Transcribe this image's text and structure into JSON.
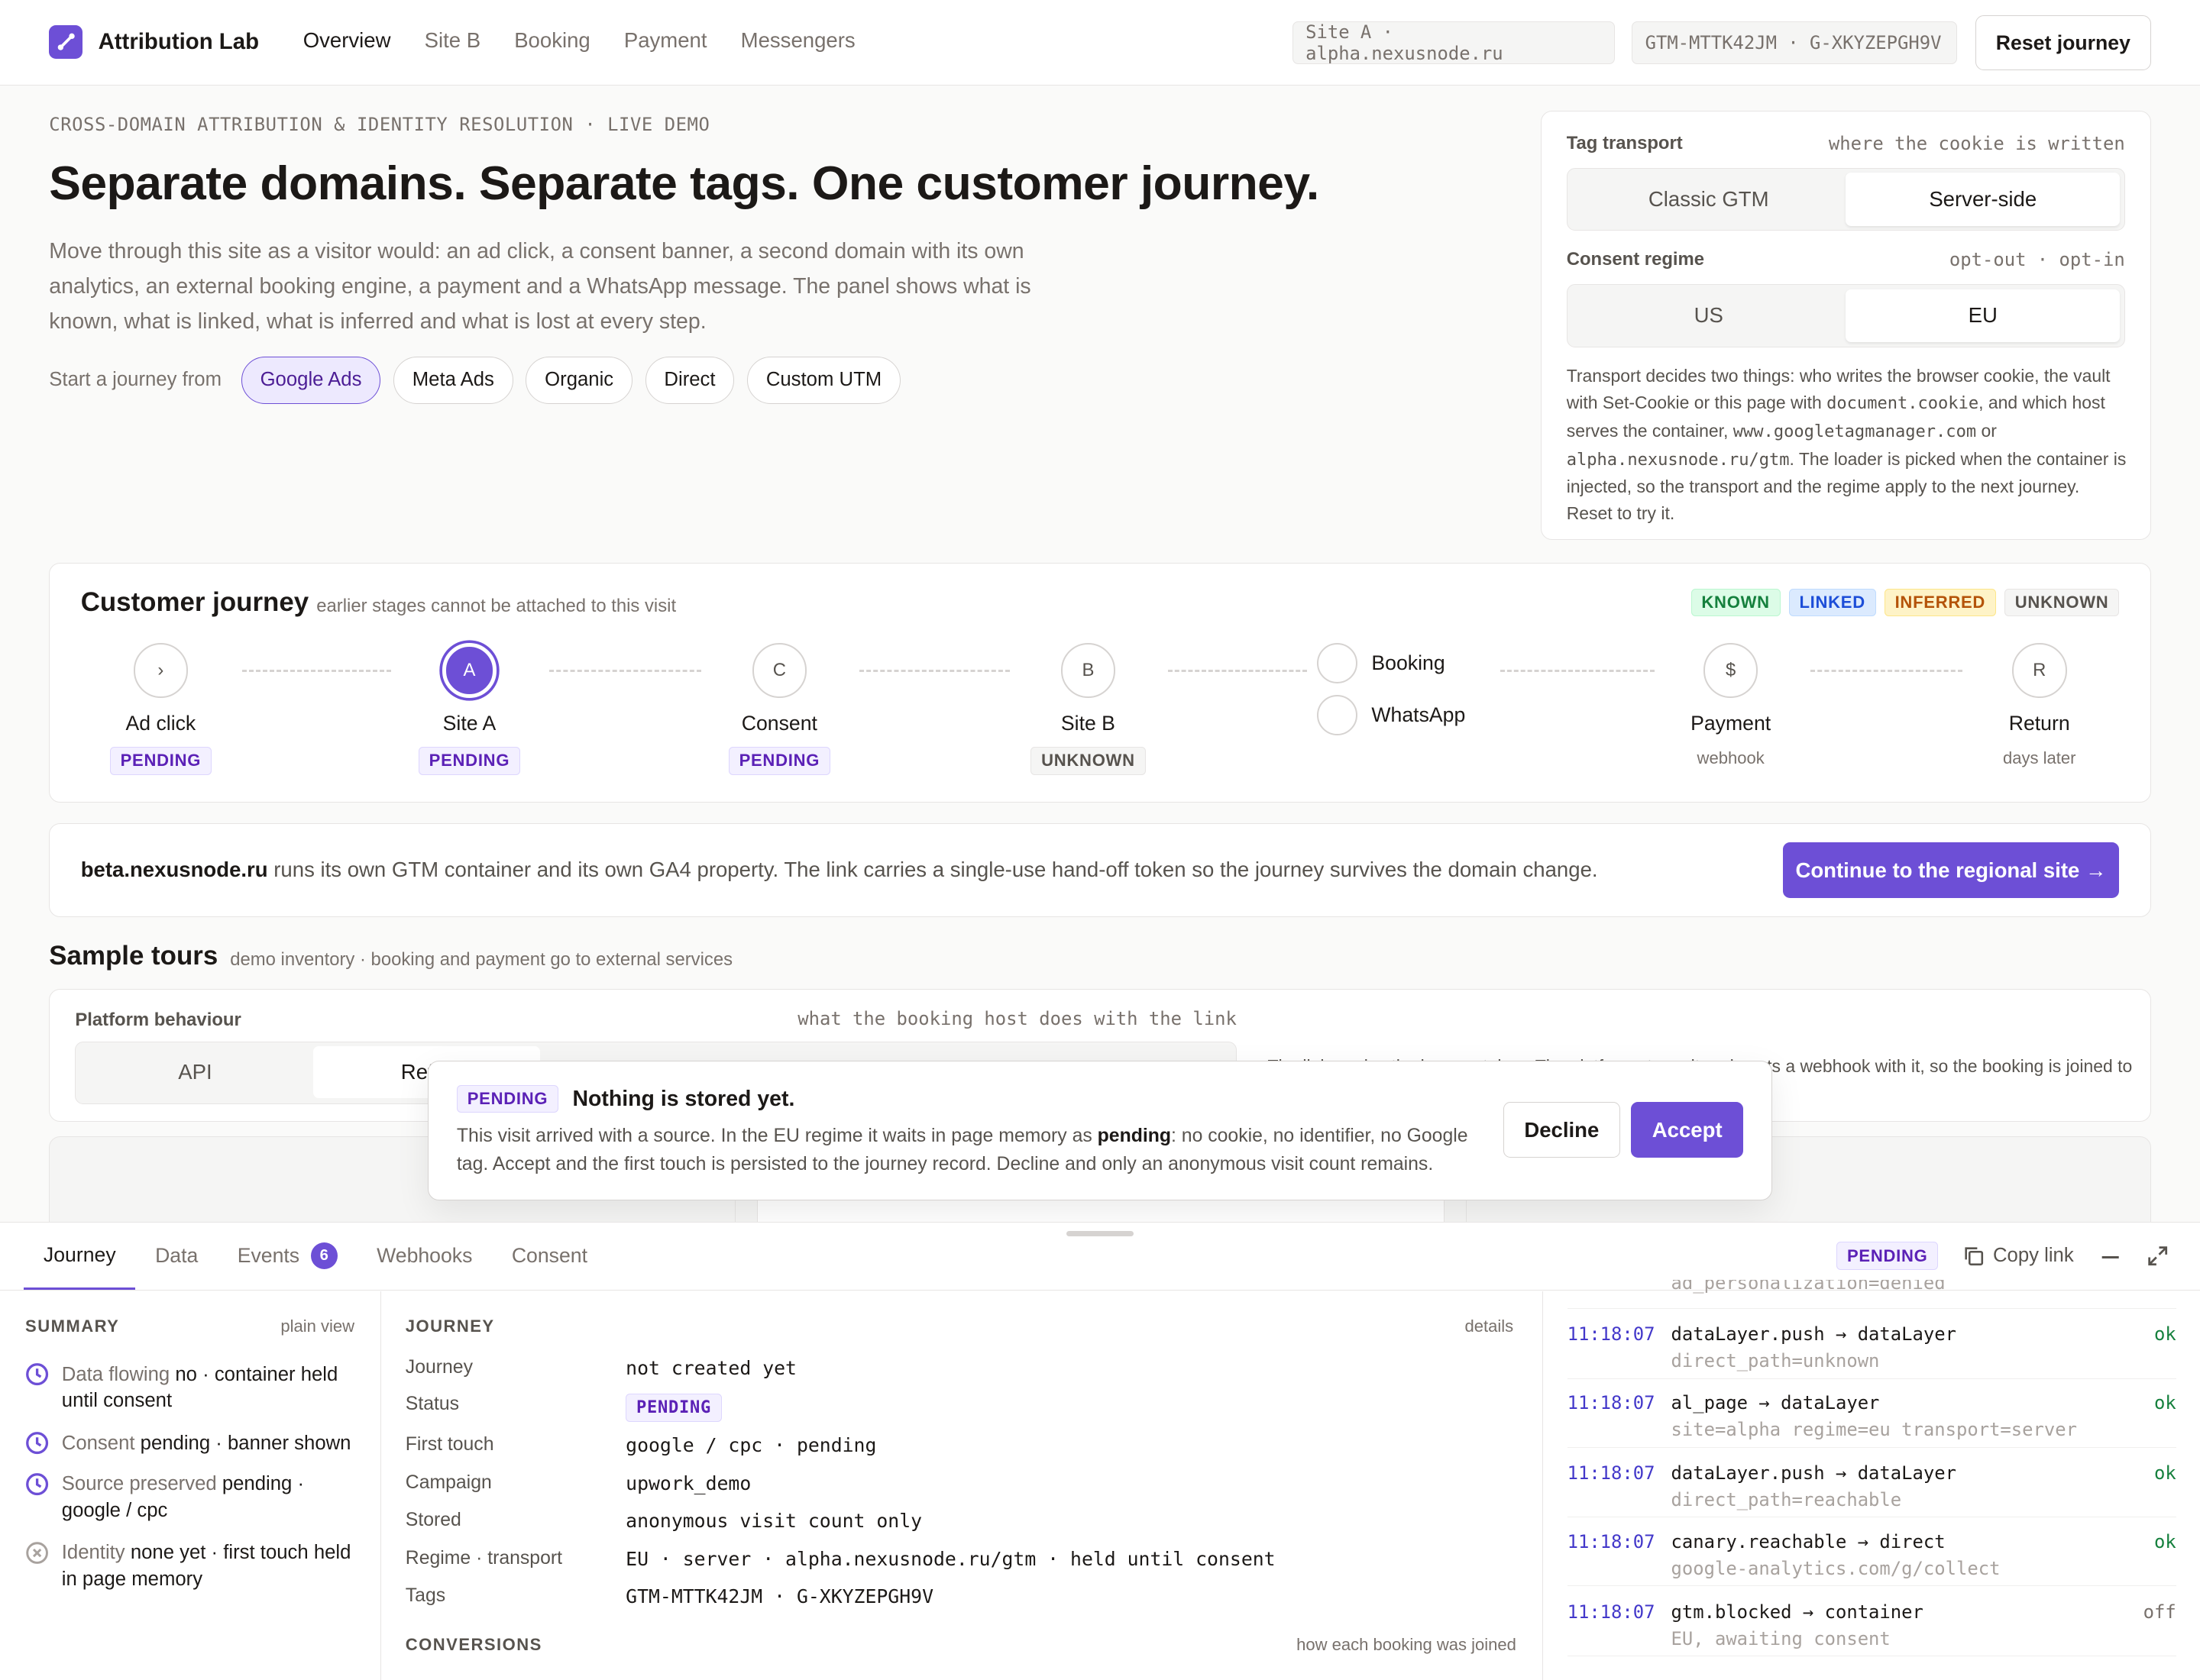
{
  "app": {
    "name": "Attribution Lab"
  },
  "nav": {
    "items": [
      "Overview",
      "Site B",
      "Booking",
      "Payment",
      "Messengers"
    ],
    "active": "Overview"
  },
  "header": {
    "site_chip": "Site A · alpha.nexusnode.ru",
    "tags_chip": "GTM-MTTK42JM · G-XKYZEPGH9V",
    "reset_label": "Reset journey"
  },
  "hero": {
    "eyebrow": "CROSS-DOMAIN ATTRIBUTION & IDENTITY RESOLUTION · LIVE DEMO",
    "title": "Separate domains. Separate tags. One customer journey.",
    "lead": "Move through this site as a visitor would: an ad click, a consent banner, a second domain with its own analytics, an external booking engine, a payment and a WhatsApp message. The panel shows what is known, what is linked, what is inferred and what is lost at every step.",
    "start_label": "Start a journey from",
    "sources": [
      "Google Ads",
      "Meta Ads",
      "Organic",
      "Direct",
      "Custom UTM"
    ],
    "selected_source": "Google Ads"
  },
  "settings": {
    "transport_label": "Tag transport",
    "transport_hint": "where the cookie is written",
    "transport_options": [
      "Classic GTM",
      "Server-side"
    ],
    "transport_selected": "Server-side",
    "regime_label": "Consent regime",
    "regime_hint": "opt-out · opt-in",
    "regime_options": [
      "US",
      "EU"
    ],
    "regime_selected": "EU",
    "note_1": "Transport decides two things: who writes the browser cookie, the vault with Set-Cookie or this page with",
    "note_code_1": "document.cookie",
    "note_2": ", and which host serves the container,",
    "note_code_2": "www.googletagmanager.com",
    "note_3": "or",
    "note_code_3": "alpha.nexusnode.ru/gtm",
    "note_4": ". The loader is picked when the container is injected, so the transport and the regime apply to the next journey. Reset to try it."
  },
  "journey": {
    "title": "Customer journey",
    "subtitle": "earlier stages cannot be attached to this visit",
    "legend": [
      "KNOWN",
      "LINKED",
      "INFERRED",
      "UNKNOWN"
    ],
    "stages": [
      {
        "glyph": "›",
        "name": "Ad click",
        "tag": "PENDING"
      },
      {
        "glyph": "A",
        "name": "Site A",
        "tag": "PENDING"
      },
      {
        "glyph": "C",
        "name": "Consent",
        "tag": "PENDING"
      },
      {
        "glyph": "B",
        "name": "Site B",
        "tag": "UNKNOWN"
      },
      {
        "glyph": "$",
        "name": "Payment",
        "sub": "webhook"
      },
      {
        "glyph": "R",
        "name": "Return",
        "sub": "days later"
      }
    ],
    "branch": [
      "Booking",
      "WhatsApp"
    ]
  },
  "handoff": {
    "domain": "beta.nexusnode.ru",
    "text": " runs its own GTM container and its own GA4 property. The link carries a single-use hand-off token so the journey survives the domain change.",
    "cta": "Continue to the regional site →"
  },
  "tours": {
    "title": "Sample tours",
    "subtitle": "demo inventory · booking and payment go to external services",
    "platform_label": "Platform behaviour",
    "platform_hint": "what the booking host does with the link",
    "platform_options": [
      "API",
      "Refer"
    ],
    "platform_note": "The link carries the journey token. The platform stores it and posts a webhook with it, so the booking is joined to the journey. Without a token the link would carry no reference."
  },
  "consent_modal": {
    "tag": "PENDING",
    "title": "Nothing is stored yet.",
    "body_1": "This visit arrived with a source. In the EU regime it waits in page memory as ",
    "body_bold": "pending",
    "body_2": ": no cookie, no identifier, no Google tag. Accept and the first touch is persisted to the journey record. Decline and only an anonymous visit count remains.",
    "decline": "Decline",
    "accept": "Accept"
  },
  "drawer": {
    "tabs": [
      "Journey",
      "Data",
      "Events",
      "Webhooks",
      "Consent"
    ],
    "active_tab": "Journey",
    "events_count": "6",
    "status_tag": "PENDING",
    "copy_link": "Copy link",
    "summary": {
      "title": "SUMMARY",
      "hint": "plain view",
      "items": [
        {
          "label": "Data flowing",
          "value": "no · container held until consent",
          "icon": "clock-icon"
        },
        {
          "label": "Consent",
          "value": "pending · banner shown",
          "icon": "clock-icon"
        },
        {
          "label": "Source preserved",
          "value": "pending · google / cpc",
          "icon": "clock-icon"
        },
        {
          "label": "Identity",
          "value": "none yet · first touch held in page memory",
          "icon": "x-circle-icon"
        }
      ]
    },
    "journey_section": {
      "title": "JOURNEY",
      "hint": "details",
      "rows": [
        {
          "k": "Journey",
          "v": "not created yet"
        },
        {
          "k": "Status",
          "v": "PENDING"
        },
        {
          "k": "First touch",
          "v": "google / cpc · pending"
        },
        {
          "k": "Campaign",
          "v": "upwork_demo"
        },
        {
          "k": "Stored",
          "v": "anonymous visit count only"
        },
        {
          "k": "Regime · transport",
          "v": "EU · server · alpha.nexusnode.ru/gtm · held until consent"
        },
        {
          "k": "Tags",
          "v": "GTM-MTTK42JM · G-XKYZEPGH9V"
        }
      ],
      "conversions_title": "CONVERSIONS",
      "conversions_hint": "how each booking was joined"
    },
    "events": {
      "clipped_top": "ad_personalization=denied",
      "items": [
        {
          "time": "11:18:07",
          "name": "dataLayer.push → dataLayer",
          "detail": "direct_path=unknown",
          "status": "ok"
        },
        {
          "time": "11:18:07",
          "name": "al_page → dataLayer",
          "detail": "site=alpha regime=eu transport=server",
          "status": "ok"
        },
        {
          "time": "11:18:07",
          "name": "dataLayer.push → dataLayer",
          "detail": "direct_path=reachable",
          "status": "ok"
        },
        {
          "time": "11:18:07",
          "name": "canary.reachable → direct",
          "detail": "google-analytics.com/g/collect",
          "status": "ok"
        },
        {
          "time": "11:18:07",
          "name": "gtm.blocked → container",
          "detail": "EU, awaiting consent",
          "status": "off"
        }
      ]
    }
  }
}
